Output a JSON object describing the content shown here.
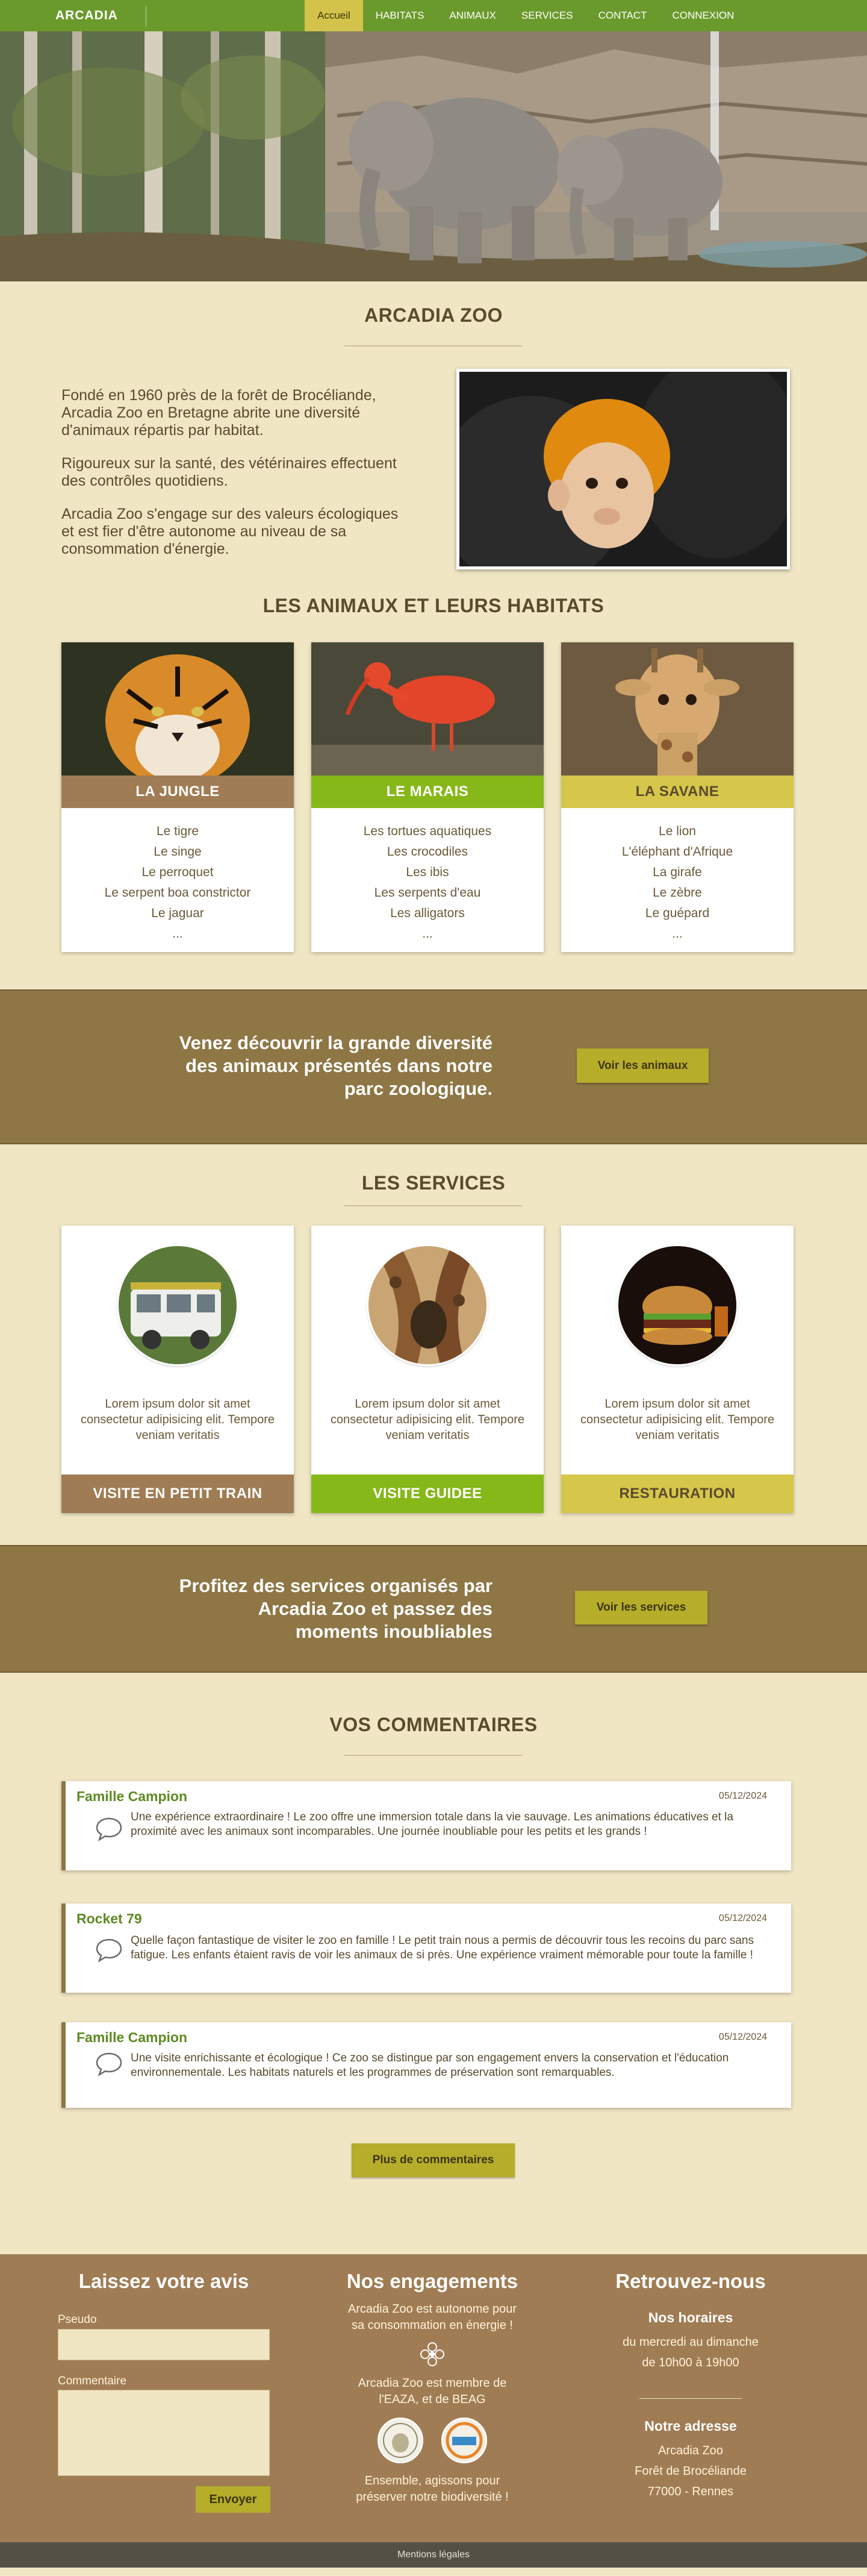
{
  "nav": {
    "brand": "ARCADIA",
    "links": [
      "Accueil",
      "HABITATS",
      "ANIMAUX",
      "SERVICES",
      "CONTACT",
      "CONNEXION"
    ]
  },
  "intro": {
    "title": "ARCADIA ZOO",
    "paragraphs": [
      "Fondé en 1960 près de la forêt de Brocéliande, Arcadia Zoo en Bretagne abrite une diversité d'animaux répartis par habitat.",
      "Rigoureux sur la santé, des vétérinaires effectuent des contrôles quotidiens.",
      "Arcadia Zoo s'engage sur des valeurs écologiques et est fier d'être autonome au niveau de sa consommation d'énergie."
    ]
  },
  "habitats": {
    "title": "LES ANIMAUX ET LEURS HABITATS",
    "cards": [
      {
        "name": "LA JUNGLE",
        "color": "#a07c54",
        "animals": [
          "Le tigre",
          "Le singe",
          "Le perroquet",
          "Le serpent boa constrictor",
          "Le jaguar",
          "..."
        ]
      },
      {
        "name": "LE MARAIS",
        "color": "#86b81a",
        "animals": [
          "Les tortues aquatiques",
          "Les crocodiles",
          "Les ibis",
          "Les serpents d'eau",
          "Les alligators",
          "..."
        ]
      },
      {
        "name": "LA SAVANE",
        "color": "#d6c64a",
        "animals": [
          "Le lion",
          "L'éléphant d'Afrique",
          "La girafe",
          "Le zèbre",
          "Le guépard",
          "..."
        ]
      }
    ]
  },
  "cta1": {
    "text_lines": [
      "Venez découvrir la grande diversité",
      "des animaux présentés dans notre",
      "parc zoologique."
    ],
    "button": "Voir les animaux"
  },
  "services": {
    "title": "LES SERVICES",
    "cards": [
      {
        "desc": "Lorem ipsum dolor sit amet consectetur adipisicing elit. Tempore veniam veritatis",
        "name": "VISITE EN PETIT TRAIN",
        "color": "#a07c54"
      },
      {
        "desc": "Lorem ipsum dolor sit amet consectetur adipisicing elit. Tempore veniam veritatis",
        "name": "VISITE GUIDEE",
        "color": "#86b81a"
      },
      {
        "desc": "Lorem ipsum dolor sit amet consectetur adipisicing elit. Tempore veniam veritatis",
        "name": "RESTAURATION",
        "color": "#d6c64a"
      }
    ]
  },
  "cta2": {
    "text_lines": [
      "Profitez des services organisés par",
      "Arcadia Zoo et passez des",
      "moments inoubliables"
    ],
    "button": "Voir les services"
  },
  "comments": {
    "title": "VOS COMMENTAIRES",
    "items": [
      {
        "name": "Famille Campion",
        "date": "05/12/2024",
        "text": "Une expérience extraordinaire ! Le zoo offre une immersion totale dans la vie sauvage. Les animations éducatives et la proximité avec les animaux sont incomparables. Une journée inoubliable pour les petits et les grands !"
      },
      {
        "name": "Rocket 79",
        "date": "05/12/2024",
        "text": "Quelle façon fantastique de visiter le zoo en famille ! Le petit train nous a permis de découvrir tous les recoins du parc sans fatigue. Les enfants étaient ravis de voir les animaux de si près. Une expérience vraiment mémorable pour toute la famille !"
      },
      {
        "name": "Famille Campion",
        "date": "05/12/2024",
        "text": "Une visite enrichissante et écologique ! Ce zoo se distingue par son engagement envers la conservation et l'éducation environnementale. Les habitats naturels et les programmes de préservation sont remarquables."
      }
    ],
    "more_button": "Plus de commentaires"
  },
  "footer": {
    "form": {
      "title": "Laissez votre avis",
      "pseudo_label": "Pseudo",
      "comment_label": "Commentaire",
      "submit": "Envoyer"
    },
    "engagements": {
      "title": "Nos engagements",
      "p1": "Arcadia Zoo est autonome pour sa consommation en énergie !",
      "p2": "Arcadia Zoo est membre de l'EAZA, et de BEAG",
      "p3": "Ensemble, agissons pour préserver notre biodiversité !"
    },
    "contact": {
      "title": "Retrouvez-nous",
      "hours_title": "Nos horaires",
      "hours_lines": [
        "du mercredi au dimanche",
        "de 10h00 à 19h00"
      ],
      "address_title": "Notre adresse",
      "address_lines": [
        "Arcadia Zoo",
        "Forêt de Brocéliande",
        "77000 - Rennes"
      ]
    }
  },
  "bottom": {
    "legal": "Mentions légales"
  }
}
